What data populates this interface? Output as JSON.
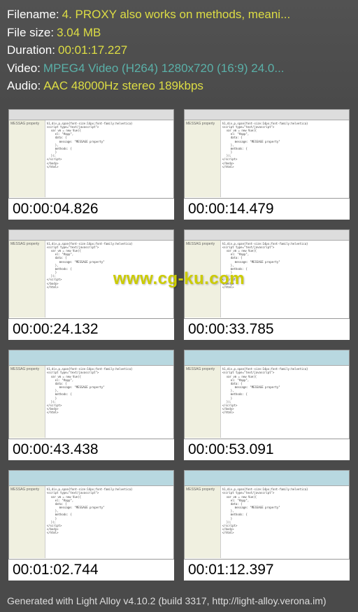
{
  "header": {
    "filename_label": "Filename:",
    "filename_value": "4. PROXY also works on methods, meani...",
    "filesize_label": "File size:",
    "filesize_value": "3.04 MB",
    "duration_label": "Duration:",
    "duration_value": "00:01:17.227",
    "video_label": "Video:",
    "video_value": "MPEG4 Video (H264) 1280x720 (16:9) 24.0...",
    "audio_label": "Audio:",
    "audio_value": "AAC 48000Hz stereo 189kbps"
  },
  "thumbnails": [
    {
      "time": "00:00:04.826",
      "variant": "editor",
      "sidebar_text": "MESSAG property"
    },
    {
      "time": "00:00:14.479",
      "variant": "editor",
      "sidebar_text": "MESSAG property"
    },
    {
      "time": "00:00:24.132",
      "variant": "editor",
      "sidebar_text": "MESSAG property"
    },
    {
      "time": "00:00:33.785",
      "variant": "editor",
      "sidebar_text": "MESSAG property"
    },
    {
      "time": "00:00:43.438",
      "variant": "browser",
      "sidebar_text": "MESSAG property"
    },
    {
      "time": "00:00:53.091",
      "variant": "browser",
      "sidebar_text": "MESSAG property"
    },
    {
      "time": "00:01:02.744",
      "variant": "browser",
      "sidebar_text": "MESSAG property"
    },
    {
      "time": "00:01:12.397",
      "variant": "browser",
      "sidebar_text": "MESSAG property"
    }
  ],
  "watermark": "www.cg-ku.com",
  "footer": "Generated with Light Alloy v4.10.2 (build 3317, http://light-alloy.verona.im)"
}
